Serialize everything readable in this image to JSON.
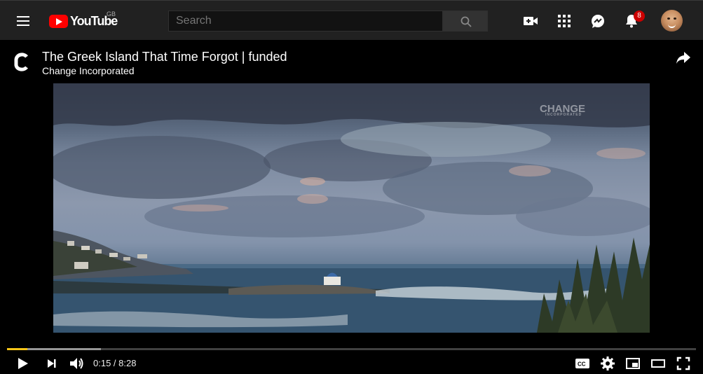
{
  "header": {
    "logo_text": "YouTube",
    "region": "GB",
    "search_placeholder": "Search",
    "notification_count": "8"
  },
  "video": {
    "title": "The Greek Island That Time Forgot | funded",
    "channel": "Change Incorporated",
    "watermark": "CHANGE",
    "watermark_sub": "INCORPORATED"
  },
  "player": {
    "current_time": "0:15",
    "separator": " / ",
    "duration": "8:28",
    "played_fraction": 0.03,
    "buffered_fraction": 0.136
  },
  "icons": {
    "menu": "menu-icon",
    "search": "search-icon",
    "create": "video-camera-icon",
    "apps": "apps-grid-icon",
    "messages": "chat-icon",
    "notifications": "bell-icon",
    "share": "share-arrow-icon",
    "play": "play-icon",
    "next": "skip-next-icon",
    "volume": "volume-icon",
    "captions": "cc-icon",
    "settings": "gear-icon",
    "miniplayer": "miniplayer-icon",
    "theater": "theater-mode-icon",
    "fullscreen": "fullscreen-icon"
  },
  "colors": {
    "brand_red": "#ff0000",
    "progress": "#f5c518",
    "badge": "#cc0000"
  }
}
